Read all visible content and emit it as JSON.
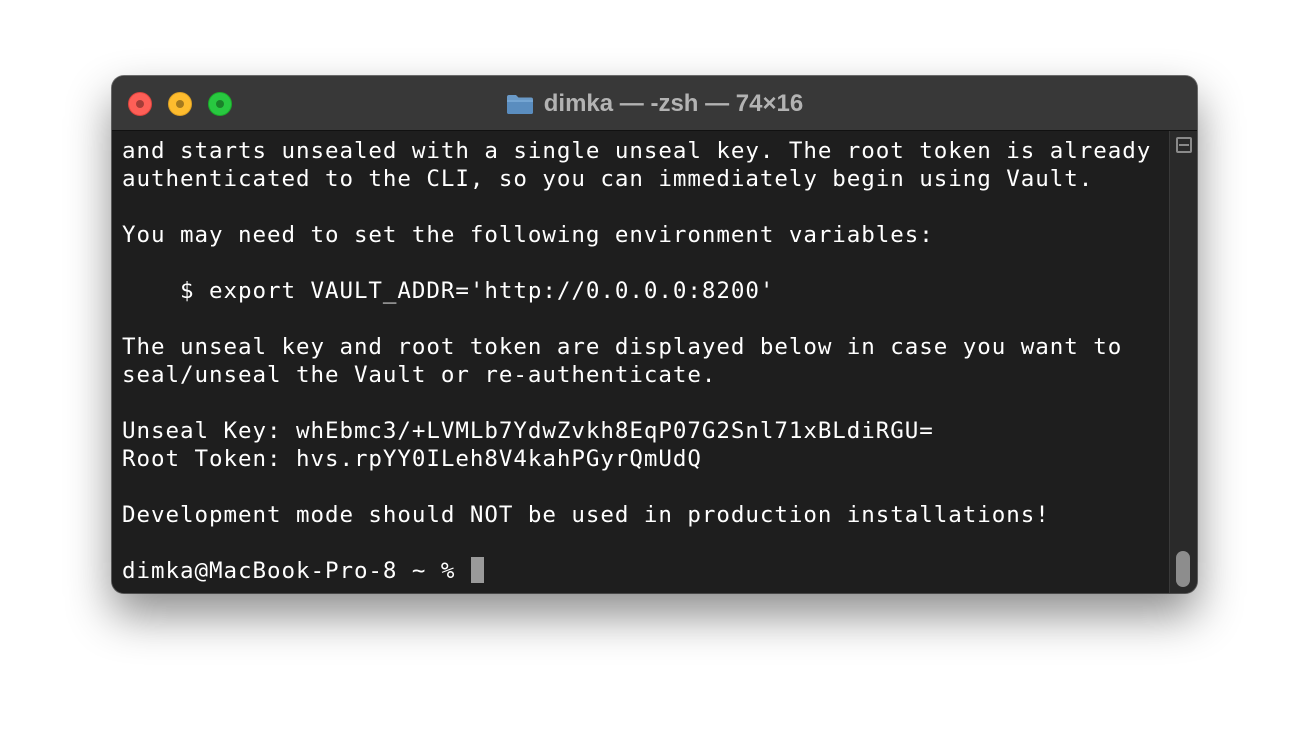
{
  "window": {
    "title": "dimka — -zsh — 74×16",
    "title_icon": "folder-icon",
    "colors": {
      "close": "#fe5f57",
      "minimize": "#febc2e",
      "zoom": "#28c840",
      "background": "#1e1e1e",
      "text": "#ffffff"
    }
  },
  "terminal": {
    "lines": [
      "and starts unsealed with a single unseal key. The root token is already",
      "authenticated to the CLI, so you can immediately begin using Vault.",
      "",
      "You may need to set the following environment variables:",
      "",
      "    $ export VAULT_ADDR='http://0.0.0.0:8200'",
      "",
      "The unseal key and root token are displayed below in case you want to",
      "seal/unseal the Vault or re-authenticate.",
      "",
      "Unseal Key: whEbmc3/+LVMLb7YdwZvkh8EqP07G2Snl71xBLdiRGU=",
      "Root Token: hvs.rpYY0ILeh8V4kahPGyrQmUdQ",
      "",
      "Development mode should NOT be used in production installations!",
      ""
    ],
    "prompt": "dimka@MacBook-Pro-8 ~ % "
  }
}
